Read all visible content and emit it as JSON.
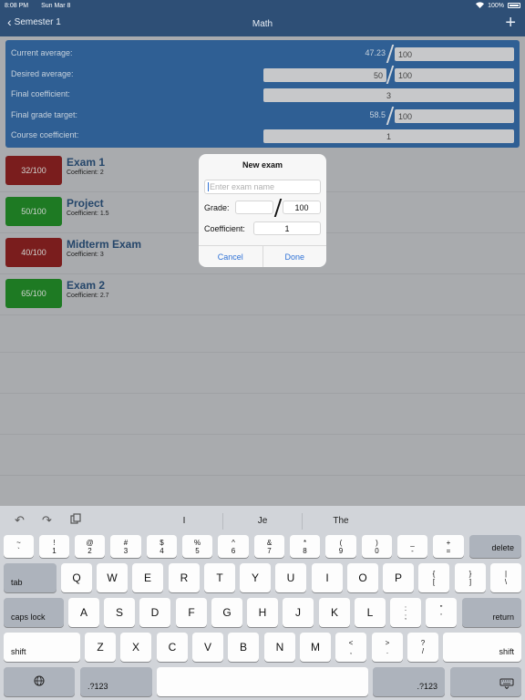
{
  "status": {
    "time": "8:08 PM",
    "date": "Sun Mar 8",
    "battery": "100%"
  },
  "nav": {
    "back_label": "Semester 1",
    "title": "Math",
    "add_icon": "plus-icon"
  },
  "summary": {
    "current_label": "Current average:",
    "current_value": "47.23",
    "current_max": "100",
    "desired_label": "Desired average:",
    "desired_value": "50",
    "desired_max": "100",
    "final_coef_label": "Final coefficient:",
    "final_coef_value": "3",
    "final_target_label": "Final grade target:",
    "final_target_value": "58.5",
    "final_target_max": "100",
    "course_coef_label": "Course coefficient:",
    "course_coef_value": "1"
  },
  "exams": [
    {
      "name": "Exam 1",
      "score": "32/100",
      "coefficient": "Coefficient: 2",
      "status": "red"
    },
    {
      "name": "Project",
      "score": "50/100",
      "coefficient": "Coefficient: 1.5",
      "status": "green"
    },
    {
      "name": "Midterm Exam",
      "score": "40/100",
      "coefficient": "Coefficient: 3",
      "status": "red"
    },
    {
      "name": "Exam 2",
      "score": "65/100",
      "coefficient": "Coefficient: 2.7",
      "status": "green"
    }
  ],
  "modal": {
    "title": "New exam",
    "name_placeholder": "Enter exam name",
    "grade_label": "Grade:",
    "grade_value": "",
    "grade_max": "100",
    "coef_label": "Coefficient:",
    "coef_value": "1",
    "cancel": "Cancel",
    "done": "Done"
  },
  "keyboard": {
    "suggestions": [
      "I",
      "Je",
      "The"
    ],
    "row1": [
      {
        "top": "~",
        "bot": "`"
      },
      {
        "top": "!",
        "bot": "1"
      },
      {
        "top": "@",
        "bot": "2"
      },
      {
        "top": "#",
        "bot": "3"
      },
      {
        "top": "$",
        "bot": "4"
      },
      {
        "top": "%",
        "bot": "5"
      },
      {
        "top": "^",
        "bot": "6"
      },
      {
        "top": "&",
        "bot": "7"
      },
      {
        "top": "*",
        "bot": "8"
      },
      {
        "top": "(",
        "bot": "9"
      },
      {
        "top": ")",
        "bot": "0"
      },
      {
        "top": "_",
        "bot": "-"
      },
      {
        "top": "+",
        "bot": "="
      }
    ],
    "delete": "delete",
    "tab": "tab",
    "row2": [
      "Q",
      "W",
      "E",
      "R",
      "T",
      "Y",
      "U",
      "I",
      "O",
      "P"
    ],
    "row2_extra": [
      {
        "top": "{",
        "bot": "["
      },
      {
        "top": "}",
        "bot": "]"
      },
      {
        "top": "|",
        "bot": "\\"
      }
    ],
    "caps": "caps lock",
    "row3": [
      "A",
      "S",
      "D",
      "F",
      "G",
      "H",
      "J",
      "K",
      "L"
    ],
    "row3_extra": [
      {
        "top": ":",
        "bot": ";"
      },
      {
        "top": "\"",
        "bot": "'"
      }
    ],
    "return": "return",
    "shift": "shift",
    "row4": [
      "Z",
      "X",
      "C",
      "V",
      "B",
      "N",
      "M"
    ],
    "row4_extra": [
      {
        "top": "<",
        "bot": ","
      },
      {
        "top": ">",
        "bot": "."
      },
      {
        "top": "?",
        "bot": "/"
      }
    ],
    "numbers": ".?123"
  }
}
